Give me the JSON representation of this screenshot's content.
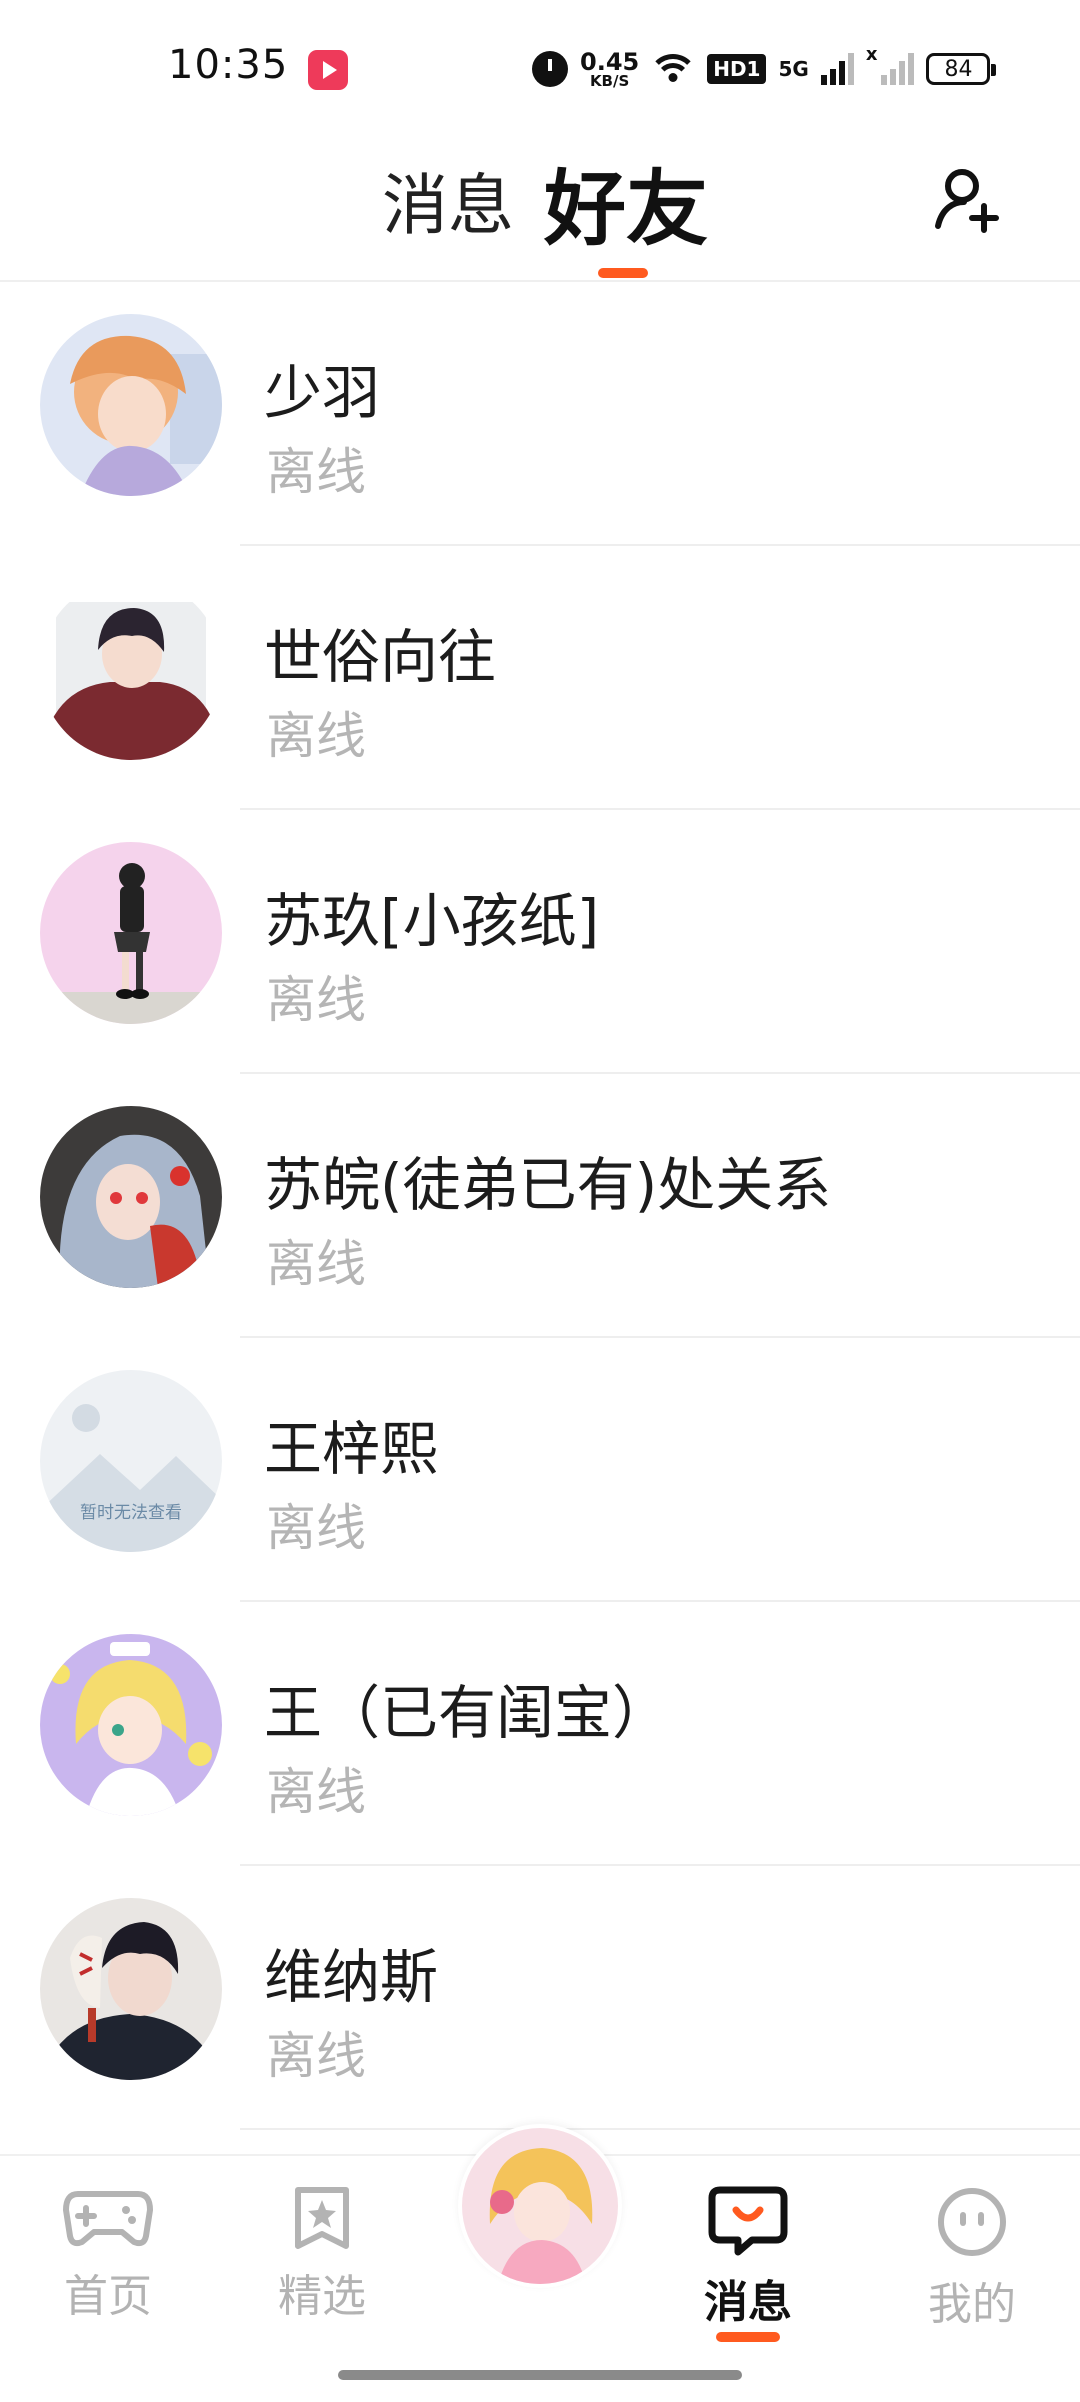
{
  "status_bar": {
    "time": "10:35",
    "net_speed": "0.45",
    "net_speed_unit": "KB/S",
    "hd_badge": "HD1",
    "network_type": "5G",
    "sim2_mark": "x",
    "battery": "84"
  },
  "header": {
    "tab_messages": "消息",
    "tab_friends": "好友",
    "active_tab": "好友",
    "accent_color": "#ff5a1f"
  },
  "friends": [
    {
      "name": "少羽",
      "status": "离线",
      "avatar": "avatar-anime-orange"
    },
    {
      "name": "世俗向往",
      "status": "离线",
      "avatar": "avatar-anime-boy-red"
    },
    {
      "name": "苏玖[小孩纸]",
      "status": "离线",
      "avatar": "avatar-anime-girl-pink"
    },
    {
      "name": "苏皖(徒弟已有)处关系",
      "status": "离线",
      "avatar": "avatar-anime-girl-dark"
    },
    {
      "name": "王梓熙",
      "status": "离线",
      "avatar": "avatar-placeholder",
      "placeholder_text": "暂时无法查看"
    },
    {
      "name": "王（已有闺宝）",
      "status": "离线",
      "avatar": "avatar-anime-girl-yellow"
    },
    {
      "name": "维纳斯",
      "status": "离线",
      "avatar": "avatar-anime-boy-mask"
    }
  ],
  "bottom_nav": {
    "items": [
      {
        "label": "首页",
        "icon": "gamepad-icon"
      },
      {
        "label": "精选",
        "icon": "star-card-icon"
      },
      {
        "label": "消息",
        "icon": "chat-bubble-icon",
        "active": true
      },
      {
        "label": "我的",
        "icon": "face-icon"
      }
    ],
    "center_icon": "avatar-center-anime"
  }
}
